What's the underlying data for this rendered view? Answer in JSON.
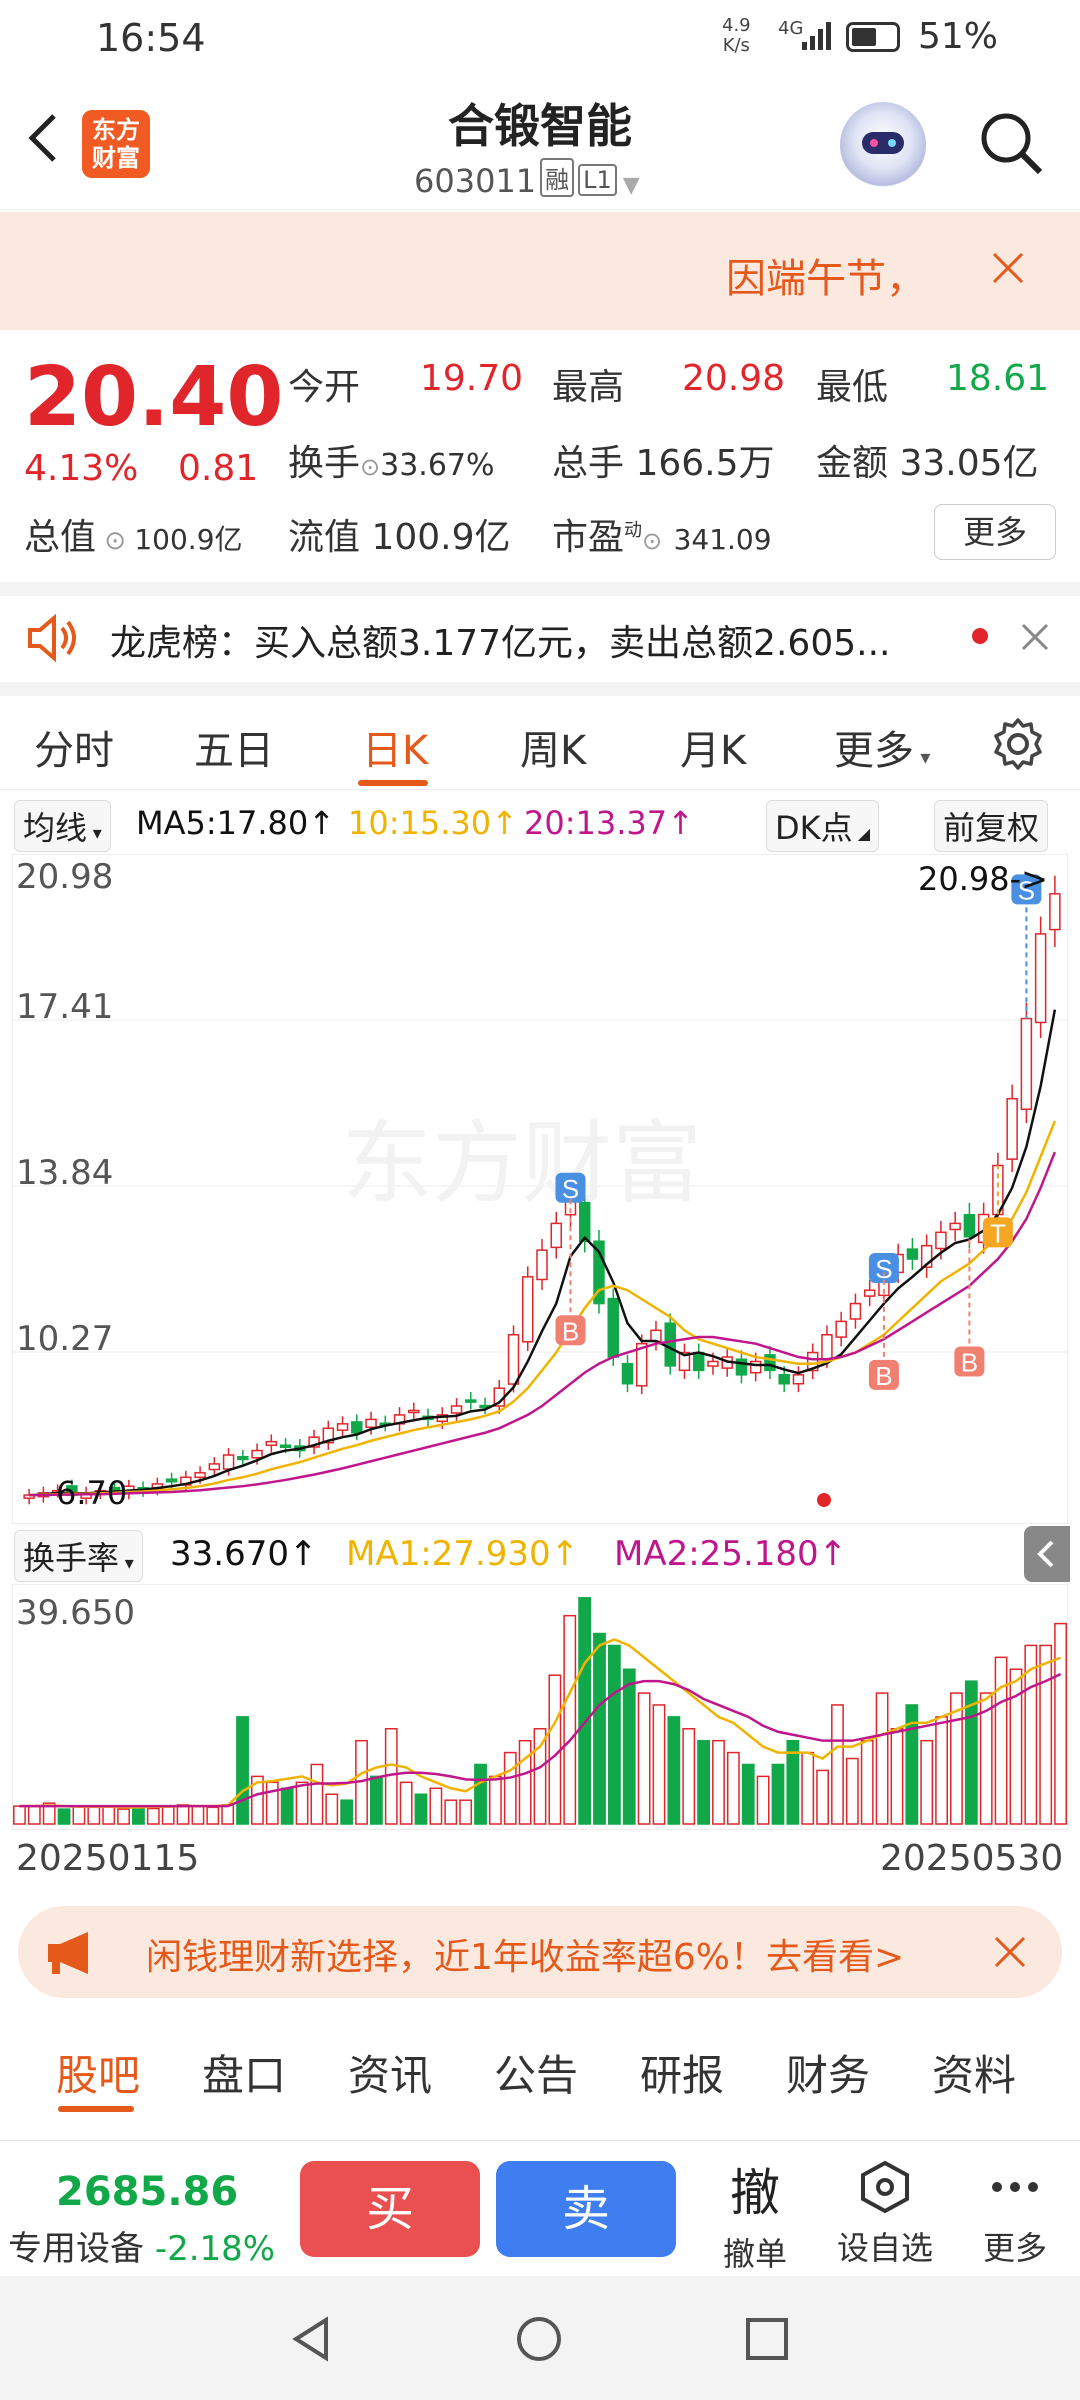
{
  "status": {
    "time": "16:54",
    "speed_value": "4.9",
    "speed_unit": "K/s",
    "network": "4G",
    "battery": "51%"
  },
  "header": {
    "title": "合锻智能",
    "code": "603011",
    "tag_margin": "融",
    "tag_level": "L1",
    "logo_line1": "东方",
    "logo_line2": "财富"
  },
  "notice": {
    "text": "因端午节，",
    "icons": [
      "close-icon"
    ]
  },
  "quote": {
    "price": "20.40",
    "change_pct": "4.13%",
    "change_amt": "0.81",
    "open_label": "今开",
    "open": "19.70",
    "high_label": "最高",
    "high": "20.98",
    "low_label": "最低",
    "low": "18.61",
    "turnover_label": "换手",
    "turnover": "33.67%",
    "volume_label": "总手",
    "volume": "166.5万",
    "amount_label": "金额",
    "amount": "33.05亿",
    "mktcap_label": "总值",
    "mktcap": "100.9亿",
    "float_label": "流值",
    "float": "100.9亿",
    "pe_label": "市盈",
    "pe_sup": "动",
    "pe": "341.09",
    "more_button": "更多"
  },
  "lhb": {
    "text": "龙虎榜：买入总额3.177亿元，卖出总额2.605..."
  },
  "chart_tabs": [
    "分时",
    "五日",
    "日K",
    "周K",
    "月K",
    "更多"
  ],
  "ma_bar": {
    "selector": "均线",
    "ma5": "MA5:17.80↑",
    "ma10": "10:15.30↑",
    "ma20": "20:13.37↑",
    "dk": "DK点",
    "adjust": "前复权"
  },
  "colors": {
    "up": "#e0252b",
    "down": "#11a84a",
    "ma5": "#111111",
    "ma10": "#f0b400",
    "ma20": "#c0168c",
    "accent": "#e55a1b"
  },
  "chart_data": {
    "type": "candlestick",
    "watermark": "东方财富",
    "ylim": [
      6.7,
      20.98
    ],
    "y_ticks": [
      "20.98",
      "17.41",
      "13.84",
      "10.27"
    ],
    "low_label": "6.70",
    "high_label": "20.98->",
    "close": [
      6.9,
      6.95,
      7.0,
      6.9,
      6.95,
      7.0,
      7.05,
      7.1,
      7.0,
      7.15,
      7.2,
      7.3,
      7.4,
      7.6,
      7.8,
      7.7,
      7.9,
      8.1,
      8.0,
      7.9,
      8.2,
      8.4,
      8.5,
      8.3,
      8.6,
      8.5,
      8.7,
      8.8,
      8.6,
      8.7,
      8.9,
      9.0,
      8.9,
      9.3,
      10.5,
      11.8,
      12.4,
      13.0,
      13.6,
      12.6,
      11.2,
      10.0,
      9.4,
      10.3,
      10.6,
      9.8,
      10.1,
      9.7,
      9.9,
      10.0,
      9.6,
      9.9,
      9.7,
      9.4,
      9.6,
      10.1,
      10.5,
      10.8,
      11.2,
      11.5,
      11.9,
      12.3,
      12.2,
      12.5,
      12.8,
      13.0,
      12.7,
      13.2,
      14.3,
      15.8,
      17.6,
      19.5,
      20.4
    ],
    "ma5": [
      6.9,
      6.92,
      6.95,
      6.94,
      6.94,
      6.96,
      6.98,
      7.0,
      7.02,
      7.06,
      7.1,
      7.15,
      7.23,
      7.33,
      7.46,
      7.56,
      7.68,
      7.82,
      7.9,
      7.94,
      8.02,
      8.12,
      8.2,
      8.26,
      8.38,
      8.46,
      8.52,
      8.58,
      8.64,
      8.66,
      8.68,
      8.78,
      8.82,
      8.98,
      9.32,
      9.9,
      10.58,
      11.2,
      12.26,
      12.68,
      12.36,
      11.68,
      10.76,
      10.36,
      10.36,
      10.2,
      10.04,
      10.1,
      10.02,
      9.9,
      9.86,
      9.82,
      9.82,
      9.72,
      9.64,
      9.74,
      9.86,
      10.06,
      10.44,
      10.82,
      11.2,
      11.54,
      11.8,
      12.08,
      12.34,
      12.56,
      12.64,
      12.84,
      13.2,
      13.8,
      14.72,
      16.08,
      17.8
    ],
    "ma10": [
      6.9,
      6.91,
      6.92,
      6.93,
      6.93,
      6.94,
      6.95,
      6.97,
      6.98,
      7.0,
      7.03,
      7.06,
      7.1,
      7.16,
      7.24,
      7.3,
      7.38,
      7.48,
      7.56,
      7.64,
      7.74,
      7.84,
      7.94,
      8.02,
      8.12,
      8.2,
      8.28,
      8.36,
      8.42,
      8.48,
      8.54,
      8.6,
      8.68,
      8.78,
      9.0,
      9.3,
      9.7,
      10.1,
      10.6,
      11.1,
      11.5,
      11.6,
      11.5,
      11.3,
      11.1,
      10.9,
      10.6,
      10.4,
      10.3,
      10.2,
      10.1,
      10.0,
      9.95,
      9.9,
      9.85,
      9.85,
      9.9,
      10.0,
      10.1,
      10.3,
      10.5,
      10.8,
      11.1,
      11.4,
      11.7,
      11.9,
      12.1,
      12.4,
      12.7,
      13.1,
      13.7,
      14.5,
      15.3
    ],
    "ma20": [
      6.9,
      6.9,
      6.91,
      6.91,
      6.92,
      6.92,
      6.93,
      6.94,
      6.95,
      6.96,
      6.97,
      6.99,
      7.01,
      7.04,
      7.07,
      7.1,
      7.14,
      7.19,
      7.24,
      7.3,
      7.36,
      7.43,
      7.5,
      7.58,
      7.66,
      7.74,
      7.82,
      7.9,
      7.98,
      8.06,
      8.14,
      8.22,
      8.3,
      8.4,
      8.55,
      8.7,
      8.9,
      9.15,
      9.4,
      9.65,
      9.85,
      10.0,
      10.1,
      10.2,
      10.3,
      10.35,
      10.4,
      10.45,
      10.45,
      10.4,
      10.35,
      10.3,
      10.2,
      10.1,
      10.0,
      9.95,
      9.95,
      10.0,
      10.1,
      10.25,
      10.4,
      10.6,
      10.8,
      11.0,
      11.2,
      11.4,
      11.6,
      11.9,
      12.2,
      12.6,
      13.1,
      13.8,
      14.6
    ],
    "markers": [
      {
        "type": "S",
        "index": 38,
        "price": 13.8
      },
      {
        "type": "B",
        "index": 38,
        "price": 10.6
      },
      {
        "type": "S",
        "index": 60,
        "price": 12.0
      },
      {
        "type": "B",
        "index": 60,
        "price": 9.6
      },
      {
        "type": "B",
        "index": 66,
        "price": 9.9
      },
      {
        "type": "T",
        "index": 68,
        "price": 12.8
      },
      {
        "type": "S",
        "index": 70,
        "price": 20.5
      }
    ]
  },
  "vol_bar": {
    "selector": "换手率",
    "value": "33.670↑",
    "ma1": "MA1:27.930↑",
    "ma2": "MA2:25.180↑",
    "ytick": "39.650"
  },
  "vol_data": {
    "ylim": [
      0,
      39.65
    ],
    "values": [
      3,
      3,
      3.5,
      2.5,
      3,
      2.8,
      3,
      2.5,
      3,
      2.6,
      3,
      3.2,
      3,
      2.8,
      3.2,
      18,
      8,
      7,
      6,
      7,
      10,
      5,
      4,
      14,
      8,
      16,
      7,
      5,
      6,
      4,
      4,
      10,
      8,
      12,
      14,
      16,
      25,
      35,
      38,
      32,
      30,
      26,
      22,
      20,
      18,
      16,
      14,
      14,
      12,
      10,
      8,
      10,
      14,
      12,
      9,
      20,
      11,
      14,
      22,
      16,
      20,
      14,
      18,
      22,
      24,
      22,
      28,
      26,
      30,
      30,
      33.67
    ],
    "ma1": [
      3,
      3,
      3.1,
      3,
      2.9,
      2.9,
      2.9,
      2.8,
      2.8,
      2.9,
      2.9,
      3,
      3,
      3,
      3.1,
      5.5,
      7,
      7.2,
      7.6,
      8,
      7,
      6.5,
      6.8,
      8.5,
      9.5,
      10,
      9.5,
      8,
      7,
      6,
      5.5,
      7,
      8,
      9,
      11,
      13,
      17,
      22,
      27,
      30,
      31,
      30,
      28,
      26,
      24,
      22,
      20,
      18,
      17,
      15,
      13,
      12,
      12,
      12,
      11,
      13,
      13,
      14,
      15,
      16,
      17,
      17,
      18,
      19,
      20,
      21,
      23,
      24,
      26,
      27,
      27.93
    ],
    "ma2": [
      3,
      3,
      3,
      3,
      3,
      3,
      3,
      3,
      3,
      3,
      3,
      3,
      3,
      3,
      3,
      4,
      5,
      5.5,
      6,
      6.5,
      6.8,
      6.8,
      6.9,
      7.2,
      7.8,
      8.3,
      8.6,
      8.6,
      8.4,
      8,
      7.5,
      7.4,
      7.5,
      7.8,
      8.5,
      9.5,
      11.5,
      14,
      17,
      20,
      22,
      23.5,
      24,
      24,
      23.5,
      22.5,
      21,
      20,
      19,
      18,
      16.5,
      15.5,
      15,
      14.5,
      14,
      14,
      14,
      14.5,
      15,
      15.5,
      16,
      16.5,
      17,
      17.5,
      18,
      19,
      20.5,
      21.5,
      23,
      24,
      25.18
    ]
  },
  "dates": {
    "start": "20250115",
    "end": "20250530"
  },
  "ad": {
    "text": "闲钱理财新选择，近1年收益率超6%！去看看>"
  },
  "info_tabs": [
    "股吧",
    "盘口",
    "资讯",
    "公告",
    "研报",
    "财务",
    "资料"
  ],
  "bottom": {
    "index_value": "2685.86",
    "sector": "专用设备",
    "sector_change": "-2.18%",
    "buy": "买",
    "sell": "卖",
    "cancel_icon": "撤",
    "cancel_label": "撤单",
    "watch_label": "设自选",
    "more_label": "更多"
  }
}
